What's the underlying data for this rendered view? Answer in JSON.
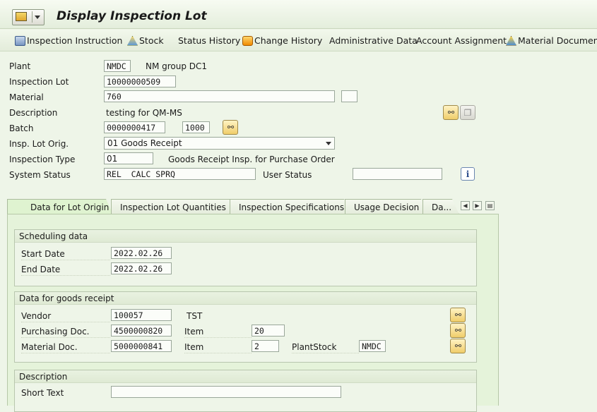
{
  "header": {
    "title": "Display Inspection Lot"
  },
  "toolbar": {
    "items": [
      {
        "label": "Inspection Instruction",
        "icon": "printer-icon"
      },
      {
        "label": "Stock",
        "icon": "stock-icon"
      },
      {
        "label": "Status History",
        "icon": ""
      },
      {
        "label": "Change History",
        "icon": "change-history-icon"
      },
      {
        "label": "Administrative Data",
        "icon": ""
      },
      {
        "label": "Account Assignment",
        "icon": ""
      },
      {
        "label": "Material Documents",
        "icon": "material-documents-icon"
      }
    ]
  },
  "lot": {
    "plant_label": "Plant",
    "plant_value": "NMDC",
    "plant_desc": "NM group DC1",
    "lot_label": "Inspection Lot",
    "lot_value": "10000000509",
    "material_label": "Material",
    "material_value": "760",
    "material_extra": "",
    "description_label": "Description",
    "description_value": "testing for QM-MS",
    "batch_label": "Batch",
    "batch_value": "0000000417",
    "batch_plant": "1000",
    "origin_label": "Insp. Lot Orig.",
    "origin_value": "01 Goods Receipt",
    "type_label": "Inspection Type",
    "type_value": "01",
    "type_desc": "Goods Receipt Insp. for Purchase Order",
    "system_status_label": "System Status",
    "system_status_value": "REL  CALC SPRQ",
    "user_status_label": "User Status",
    "user_status_value": ""
  },
  "tabs": [
    {
      "label": "Data for Lot Origin",
      "active": true
    },
    {
      "label": "Inspection Lot Quantities",
      "active": false
    },
    {
      "label": "Inspection Specifications",
      "active": false
    },
    {
      "label": "Usage Decision",
      "active": false
    },
    {
      "label": "Da...",
      "active": false
    }
  ],
  "scheduling": {
    "title": "Scheduling data",
    "start_label": "Start Date",
    "start_value": "2022.02.26",
    "end_label": "End Date",
    "end_value": "2022.02.26"
  },
  "goods_receipt": {
    "title": "Data for goods receipt",
    "vendor_label": "Vendor",
    "vendor_value": "100057",
    "vendor_name": "TST",
    "po_label": "Purchasing Doc.",
    "po_value": "4500000820",
    "po_item_label": "Item",
    "po_item_value": "20",
    "matdoc_label": "Material Doc.",
    "matdoc_value": "5000000841",
    "matdoc_item_label": "Item",
    "matdoc_item_value": "2",
    "plantstock_label": "PlantStock",
    "plantstock_value": "NMDC"
  },
  "description_group": {
    "title": "Description",
    "short_text_label": "Short Text",
    "short_text_value": ""
  },
  "colors": {
    "background": "#eef5e8",
    "tab_active": "#dff3d0",
    "button_yellow": "#f0cd6a"
  }
}
